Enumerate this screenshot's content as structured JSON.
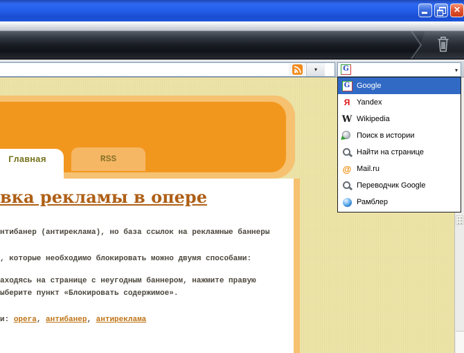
{
  "window": {
    "controls": {
      "minimize": "minimize",
      "restore": "restore",
      "close_glyph": "✕"
    }
  },
  "chrome": {
    "url_value": "",
    "rss_dropdown_arrow": "▾",
    "search_dropdown_arrow": "▾",
    "search_selected_glyph": "G"
  },
  "search_dropdown": {
    "items": [
      {
        "label": "Google",
        "glyph": "G",
        "selected": true
      },
      {
        "label": "Yandex",
        "glyph": "Я"
      },
      {
        "label": "Wikipedia",
        "glyph": "W"
      },
      {
        "label": "Поиск в истории"
      },
      {
        "label": "Найти на странице"
      },
      {
        "label": "Mail.ru",
        "glyph": "@"
      },
      {
        "label": "Переводчик Google"
      },
      {
        "label": "Рамблер"
      }
    ]
  },
  "page": {
    "tabs": [
      {
        "label": "Главная",
        "active": true
      },
      {
        "label": "RSS",
        "active": false
      }
    ],
    "heading": "вка рекламы в опере",
    "lines": [
      "нтибанер (антиреклама), но база ссылок на рекламные баннеры",
      ", которые необходимо блокировать можно двумя способами:",
      "аходясь на странице с неугодным баннером, нажмите правую",
      "ыберите пункт «Блокировать содержимое»."
    ],
    "tags": {
      "prefix": "и:",
      "separator": ", ",
      "links": [
        "opera",
        "антибанер",
        "антиреклама"
      ]
    }
  },
  "colors": {
    "titlebar_blue": "#2460EC",
    "selection_blue": "#316AC5",
    "page_beige": "#EBE2A4",
    "banner_orange": "#F2971E",
    "banner_border": "#F6C170",
    "heading_brown": "#AE5F16",
    "link_orange": "#BE7315"
  }
}
